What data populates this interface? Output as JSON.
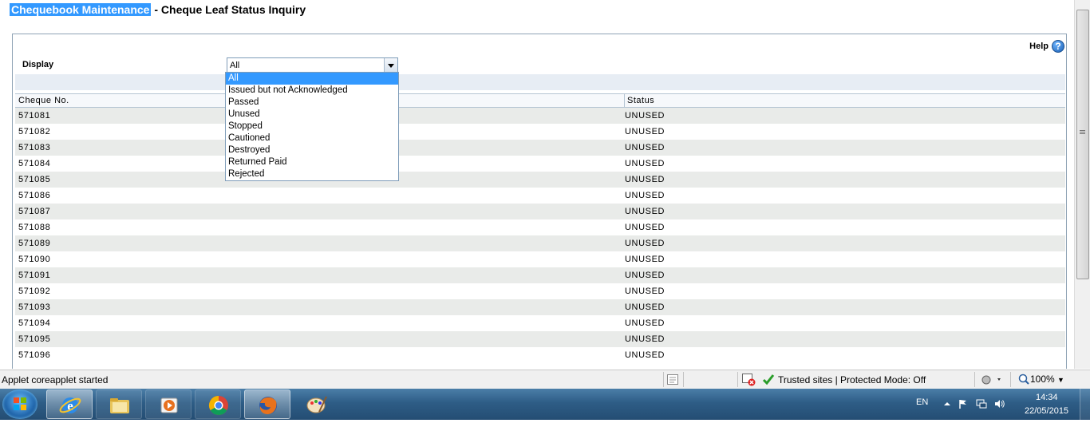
{
  "page": {
    "title_highlight": "Chequebook Maintenance",
    "title_rest": " - Cheque Leaf Status Inquiry",
    "help_label": "Help",
    "display_label": "Display",
    "display_value": "All"
  },
  "dropdown": {
    "options": [
      "All",
      "Issued but not Acknowledged",
      "Passed",
      "Unused",
      "Stopped",
      "Cautioned",
      "Destroyed",
      "Returned Paid",
      "Rejected"
    ],
    "selected": "All"
  },
  "table": {
    "headers": [
      "Cheque No.",
      "Status"
    ],
    "rows": [
      [
        "571081",
        "UNUSED"
      ],
      [
        "571082",
        "UNUSED"
      ],
      [
        "571083",
        "UNUSED"
      ],
      [
        "571084",
        "UNUSED"
      ],
      [
        "571085",
        "UNUSED"
      ],
      [
        "571086",
        "UNUSED"
      ],
      [
        "571087",
        "UNUSED"
      ],
      [
        "571088",
        "UNUSED"
      ],
      [
        "571089",
        "UNUSED"
      ],
      [
        "571090",
        "UNUSED"
      ],
      [
        "571091",
        "UNUSED"
      ],
      [
        "571092",
        "UNUSED"
      ],
      [
        "571093",
        "UNUSED"
      ],
      [
        "571094",
        "UNUSED"
      ],
      [
        "571095",
        "UNUSED"
      ],
      [
        "571096",
        "UNUSED"
      ]
    ]
  },
  "statusbar": {
    "status_text": "Applet coreapplet started",
    "zone_text": "Trusted sites | Protected Mode: Off",
    "zoom": "100%"
  },
  "taskbar": {
    "language": "EN",
    "time": "14:34",
    "date": "22/05/2015",
    "apps": [
      "internet-explorer",
      "file-explorer",
      "media-player",
      "chrome",
      "firefox",
      "paint"
    ]
  }
}
